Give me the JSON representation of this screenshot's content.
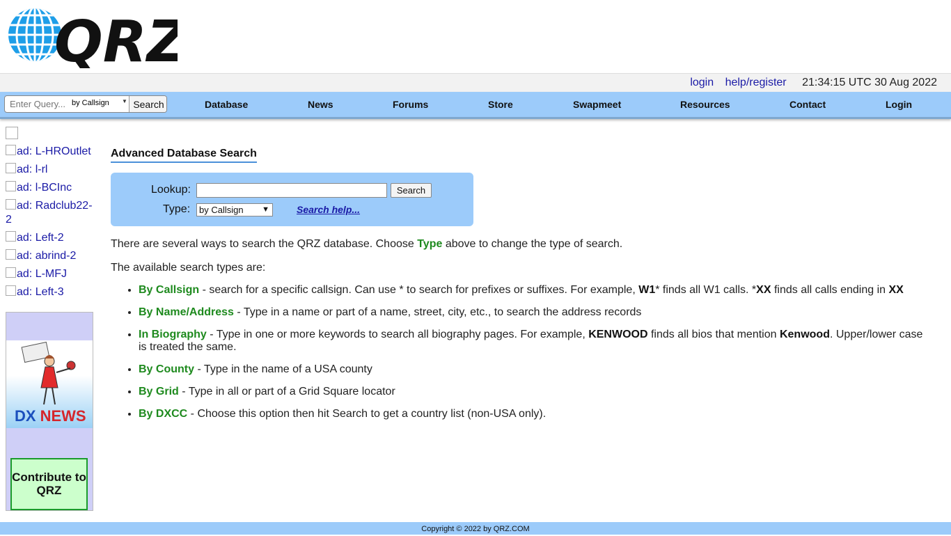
{
  "logo": {
    "text": "QRZ"
  },
  "topbar": {
    "login": "login",
    "help": "help/register",
    "clock": "21:34:15 UTC 30 Aug 2022"
  },
  "query": {
    "placeholder": "Enter Query...",
    "type": "by Callsign",
    "button": "Search"
  },
  "nav": [
    "Database",
    "News",
    "Forums",
    "Store",
    "Swapmeet",
    "Resources",
    "Contact",
    "Login"
  ],
  "ads": [
    "ad: L-HROutlet",
    "ad: l-rl",
    "ad: l-BCInc",
    "ad: Radclub22-2",
    "ad: Left-2",
    "ad: abrind-2",
    "ad: L-MFJ",
    "ad: Left-3"
  ],
  "dxnews": {
    "dx": "DX",
    "news": "NEWS"
  },
  "contribute": "Contribute to QRZ",
  "main": {
    "title": "Advanced Database Search",
    "lookup_label": "Lookup:",
    "search_button": "Search",
    "type_label": "Type:",
    "type_value": "by Callsign",
    "search_help": "Search help...",
    "intro_pre": "There are several ways to search the QRZ database. Choose ",
    "intro_type": "Type",
    "intro_post": " above to change the type of search.",
    "available": "The available search types are:",
    "types": [
      {
        "name": "By Callsign",
        "desc_a": " - search for a specific callsign. Can use * to search for prefixes or suffixes. For example, ",
        "b1": "W1",
        "desc_b": "* finds all W1 calls. *",
        "b2": "XX",
        "desc_c": " finds all calls ending in ",
        "b3": "XX"
      },
      {
        "name": "By Name/Address",
        "desc": " - Type in a name or part of a name, street, city, etc., to search the address records"
      },
      {
        "name": "In Biography",
        "desc_a": " - Type in one or more keywords to search all biography pages. For example, ",
        "b1": "KENWOOD",
        "desc_b": " finds all bios that mention ",
        "b2": "Kenwood",
        "desc_c": ". Upper/lower case is treated the same."
      },
      {
        "name": "By County",
        "desc": " - Type in the name of a USA county"
      },
      {
        "name": "By Grid",
        "desc": " - Type in all or part of a Grid Square locator"
      },
      {
        "name": "By DXCC",
        "desc": " - Choose this option then hit Search to get a country list (non-USA only)."
      }
    ]
  },
  "footer": "Copyright © 2022 by QRZ.COM"
}
